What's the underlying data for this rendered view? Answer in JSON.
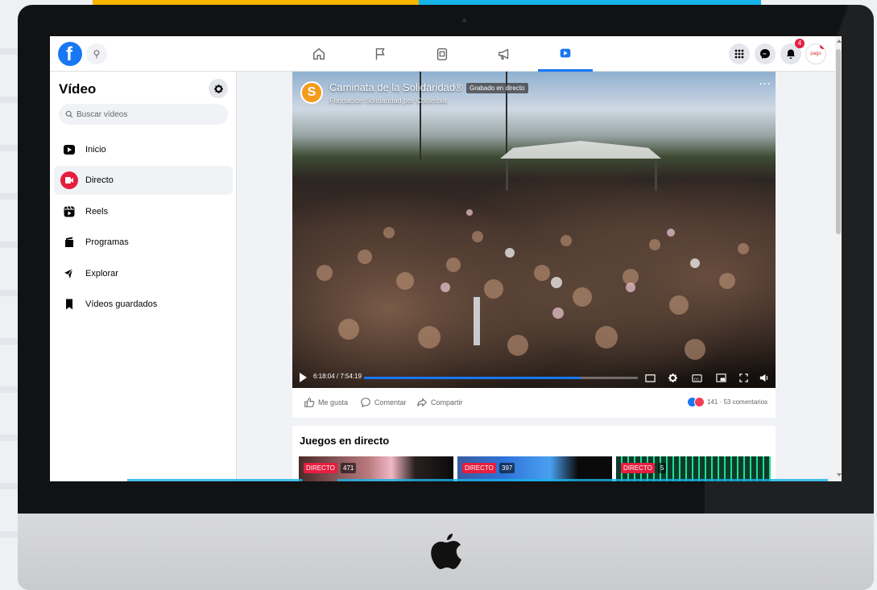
{
  "colors": {
    "brand": "#1877f2",
    "live": "#e41e3f",
    "accent_yellow": "#f7b500",
    "accent_cyan": "#16b3e9"
  },
  "topnav": {
    "logo_icon": "facebook-logo-icon",
    "tabs": [
      {
        "name": "home",
        "icon": "home-icon",
        "active": false
      },
      {
        "name": "pages",
        "icon": "flag-icon",
        "active": false
      },
      {
        "name": "marketplace",
        "icon": "storefront-icon",
        "active": false
      },
      {
        "name": "ads",
        "icon": "megaphone-icon",
        "active": false
      },
      {
        "name": "watch",
        "icon": "video-icon",
        "active": true
      }
    ],
    "notifications_count": "4",
    "avatar_text": "pago"
  },
  "sidebar": {
    "title": "Vídeo",
    "search_placeholder": "Buscar vídeos",
    "items": [
      {
        "label": "Inicio",
        "icon": "watch-home-icon",
        "active": false
      },
      {
        "label": "Directo",
        "icon": "live-icon",
        "active": true
      },
      {
        "label": "Reels",
        "icon": "reels-icon",
        "active": false
      },
      {
        "label": "Programas",
        "icon": "shows-icon",
        "active": false
      },
      {
        "label": "Explorar",
        "icon": "explore-icon",
        "active": false
      },
      {
        "label": "Vídeos guardados",
        "icon": "bookmark-icon",
        "active": false
      }
    ]
  },
  "video": {
    "channel_logo_letter": "S",
    "title": "Caminata de la Solidaridad®",
    "tag": "Grabado en directo",
    "subtitle": "Fundación Solidaridad por Colombia",
    "time": "6:18:04 / 7:54:19",
    "progress": 0.79
  },
  "actions": {
    "like": "Me gusta",
    "comment": "Comentar",
    "share": "Compartir",
    "reactions": "141 · 53 comentarios"
  },
  "games": {
    "title": "Juegos en directo",
    "items": [
      {
        "badge": "DIRECTO",
        "viewers": "471"
      },
      {
        "badge": "DIRECTO",
        "viewers": "397"
      },
      {
        "badge": "DIRECTO",
        "viewers": "5"
      }
    ]
  }
}
